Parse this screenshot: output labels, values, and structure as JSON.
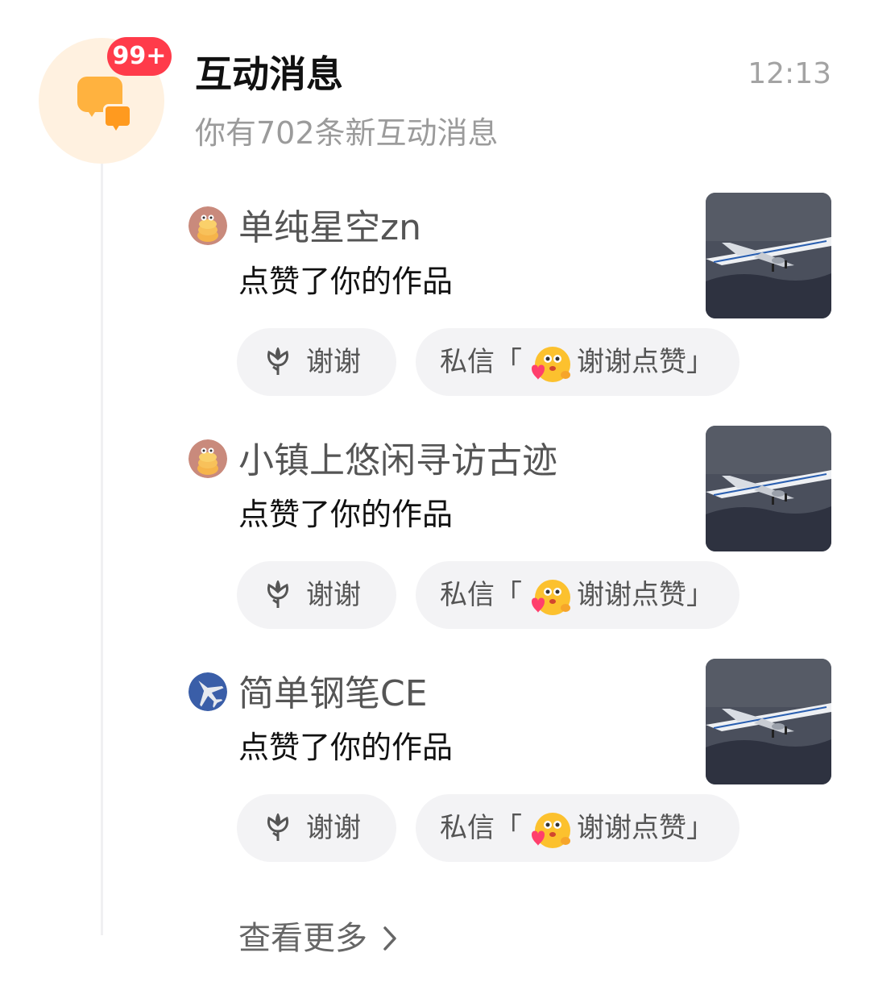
{
  "header": {
    "badge": "99+",
    "title": "互动消息",
    "time": "12:13",
    "subtitle": "你有702条新互动消息"
  },
  "items": [
    {
      "username": "单纯星空zn",
      "action": "点赞了你的作品",
      "thanks_label": "谢谢",
      "dm_prefix": "私信「",
      "dm_suffix": "谢谢点赞」",
      "avatar": "pancake-avatar"
    },
    {
      "username": "小镇上悠闲寻访古迹",
      "action": "点赞了你的作品",
      "thanks_label": "谢谢",
      "dm_prefix": "私信「",
      "dm_suffix": "谢谢点赞」",
      "avatar": "pancake-avatar"
    },
    {
      "username": "简单钢笔CE",
      "action": "点赞了你的作品",
      "thanks_label": "谢谢",
      "dm_prefix": "私信「",
      "dm_suffix": "谢谢点赞」",
      "avatar": "jet-avatar"
    }
  ],
  "footer": {
    "more_label": "查看更多"
  },
  "colors": {
    "badge": "#ff3b4a",
    "icon_bg": "#fff1e0",
    "icon_chat": "#ffb23f",
    "pill_bg": "#f3f3f5"
  }
}
